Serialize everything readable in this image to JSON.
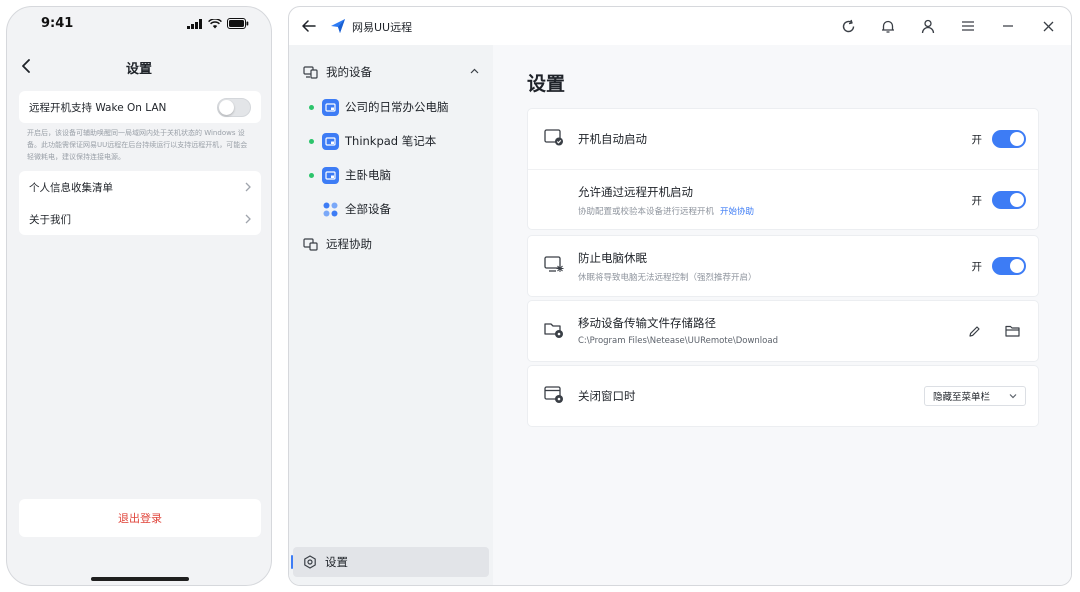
{
  "phone": {
    "status_time": "9:41",
    "title": "设置",
    "wake_on_lan_label": "远程开机支持 Wake On LAN",
    "wake_on_lan_enabled": false,
    "description": "开启后，该设备可辅助唤醒同一局域网内处于关机状态的 Windows 设备。此功能需保证网易UU远程在后台持续运行以支持远程开机，可能会轻微耗电，建议保持连接电源。",
    "menu": [
      {
        "label": "个人信息收集清单"
      },
      {
        "label": "关于我们"
      }
    ],
    "logout_label": "退出登录"
  },
  "window": {
    "app_name": "网易UU远程",
    "sidebar": {
      "my_devices_label": "我的设备",
      "devices": [
        {
          "name": "公司的日常办公电脑",
          "online": true
        },
        {
          "name": "Thinkpad 笔记本",
          "online": true
        },
        {
          "name": "主卧电脑",
          "online": true
        }
      ],
      "all_devices_label": "全部设备",
      "remote_assist_label": "远程协助",
      "settings_label": "设置"
    },
    "main": {
      "title": "设置",
      "items": {
        "auto_start": {
          "label": "开机自动启动",
          "state_text": "开",
          "enabled": true
        },
        "remote_boot": {
          "label": "允许通过远程开机启动",
          "sub": "协助配置或校验本设备进行远程开机",
          "link": "开始协助",
          "state_text": "开",
          "enabled": true
        },
        "prevent_sleep": {
          "label": "防止电脑休眠",
          "sub": "休眠将导致电脑无法远程控制（强烈推荐开启）",
          "state_text": "开",
          "enabled": true
        },
        "transfer_path": {
          "label": "移动设备传输文件存储路径",
          "path": "C:\\Program Files\\Netease\\UURemote\\Download"
        },
        "close_window": {
          "label": "关闭窗口时",
          "selected": "隐藏至菜单栏"
        }
      }
    }
  },
  "colors": {
    "accent": "#3d7cf5",
    "online": "#2cc46b",
    "danger": "#e0463c"
  }
}
